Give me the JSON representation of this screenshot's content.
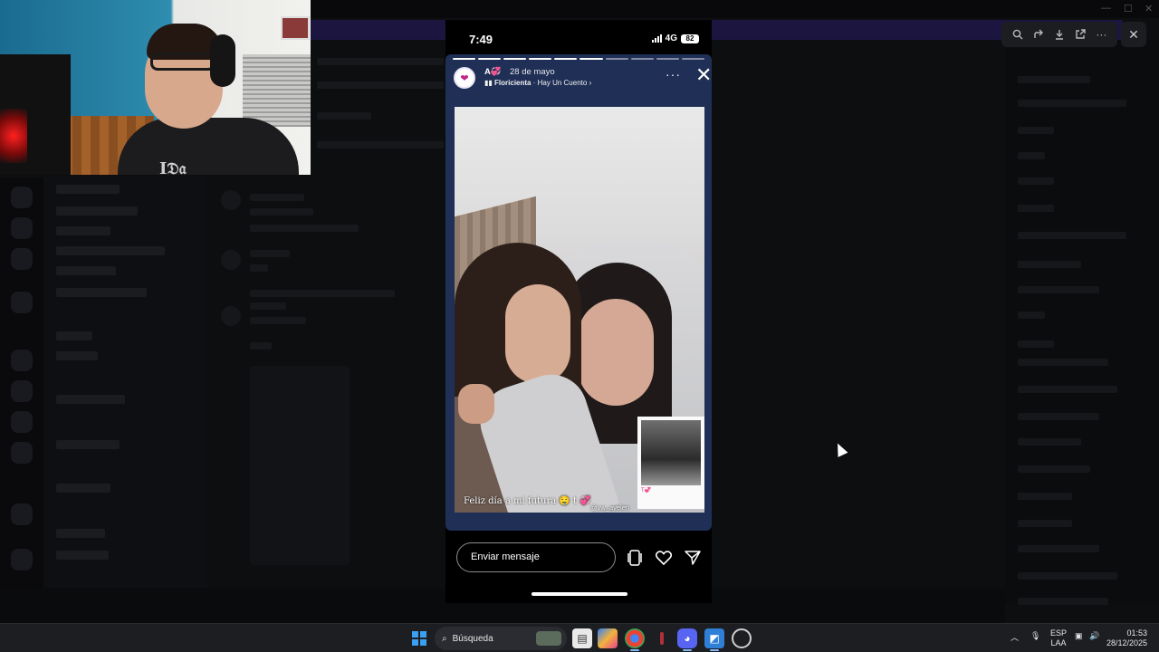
{
  "story": {
    "status_time": "7:49",
    "network": "4G",
    "battery": "82",
    "username": "A💞",
    "date": "28 de mayo",
    "music_artist": "Floricienta",
    "music_song": "Hay Un Cuento",
    "caption": "Feliz día a mi futura 🤤 t 💞",
    "mention": "@vw_ayelen",
    "polaroid_caption": "T💞",
    "reply_placeholder": "Enviar mensaje",
    "progress_segments": 10,
    "progress_done": 6
  },
  "viewer_toolbar": {
    "icons": [
      "zoom-icon",
      "forward-icon",
      "download-icon",
      "open-external-icon",
      "more-icon"
    ],
    "close_icon": "close-icon"
  },
  "taskbar": {
    "search_label": "Búsqueda",
    "language": "ESP",
    "language_sub": "LAA",
    "time": "01:53",
    "date": "28/12/2025",
    "apps": [
      "file-explorer-icon",
      "copilot-icon",
      "chrome-icon",
      "app-icon",
      "discord-icon",
      "photos-icon",
      "steam-icon"
    ]
  },
  "colors": {
    "accent_pink": "#c2248a",
    "taskbar_bg": "#1d1e22",
    "story_bg": "#1f2f55"
  }
}
